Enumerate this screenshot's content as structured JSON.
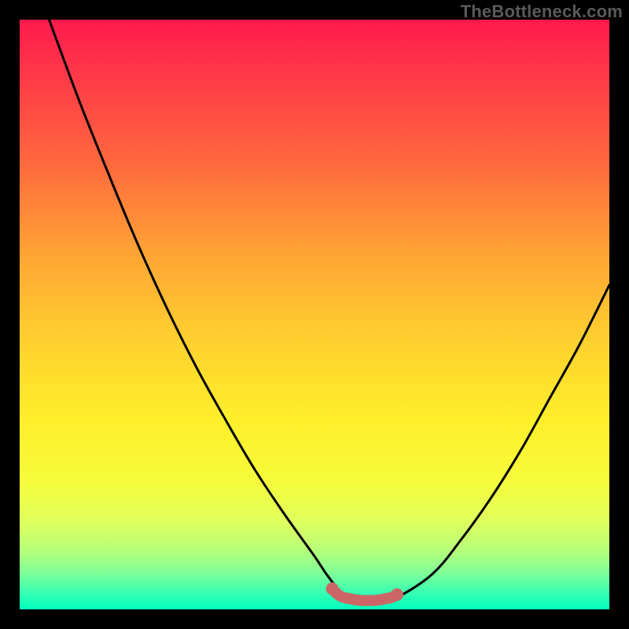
{
  "attribution": "TheBottleneck.com",
  "chart_data": {
    "type": "line",
    "title": "",
    "xlabel": "",
    "ylabel": "",
    "xlim": [
      0,
      100
    ],
    "ylim": [
      0,
      100
    ],
    "grid": false,
    "series": [
      {
        "name": "bottleneck-curve",
        "x": [
          5,
          10,
          15,
          20,
          25,
          30,
          35,
          40,
          45,
          50,
          52,
          54,
          56,
          58,
          60,
          62,
          64,
          70,
          75,
          80,
          85,
          90,
          95,
          100
        ],
        "values": [
          100,
          86.5,
          74,
          62,
          51,
          41,
          32,
          23.5,
          16,
          9,
          6,
          3.5,
          2,
          1.5,
          1.5,
          1.5,
          2,
          6,
          12,
          19,
          27,
          36,
          45,
          55
        ]
      },
      {
        "name": "optimal-zone",
        "x": [
          53,
          54,
          55,
          56,
          57,
          58,
          59,
          60,
          61,
          62,
          63,
          64
        ],
        "values": [
          3.5,
          2.5,
          2,
          1.8,
          1.6,
          1.5,
          1.5,
          1.5,
          1.6,
          1.8,
          2,
          2.5
        ]
      }
    ],
    "annotations": []
  }
}
